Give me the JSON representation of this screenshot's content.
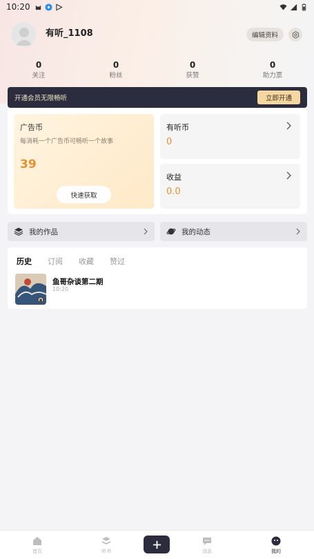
{
  "status_bar": {
    "time": "10:20"
  },
  "profile": {
    "username": "有听_1108",
    "edit_label": "编辑资料"
  },
  "stats": [
    {
      "value": "0",
      "label": "关注"
    },
    {
      "value": "0",
      "label": "粉丝"
    },
    {
      "value": "0",
      "label": "获赞"
    },
    {
      "value": "0",
      "label": "助力票"
    }
  ],
  "vip": {
    "text": "开通会员无限畅听",
    "button_label": "立即开通"
  },
  "wallet": {
    "ad_coin": {
      "title": "广告币",
      "description": "每消耗一个广告币可畅听一个故事",
      "value": "39",
      "button_label": "快速获取"
    },
    "youting_coin": {
      "title": "有听币",
      "value": "0"
    },
    "earnings": {
      "title": "收益",
      "value": "0.0"
    }
  },
  "links": {
    "my_works": "我的作品",
    "my_updates": "我的动态"
  },
  "history": {
    "tabs": [
      "历史",
      "订阅",
      "收藏",
      "赞过"
    ],
    "active_tab": "历史",
    "items": [
      {
        "title": "鱼哥杂谈第二期",
        "time": "10:20"
      }
    ]
  },
  "bottom_nav": {
    "items": [
      {
        "label": "首页",
        "icon": "home-icon"
      },
      {
        "label": "听书",
        "icon": "book-icon"
      },
      {
        "label": "",
        "icon": "plus-icon"
      },
      {
        "label": "消息",
        "icon": "message-icon"
      },
      {
        "label": "我的",
        "icon": "profile-icon"
      }
    ],
    "active": "我的"
  },
  "colors": {
    "accent_gold": "#e3932d",
    "vip_dark": "#2b2d3f",
    "vip_button": "#f6d7a2"
  }
}
